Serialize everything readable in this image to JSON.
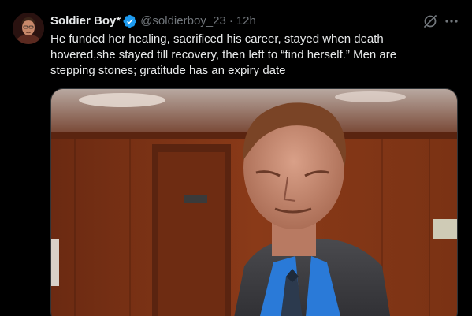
{
  "tweet": {
    "author": {
      "name": "Soldier Boy*",
      "handle": "@soldierboy_23",
      "avatar_icon": "avatar"
    },
    "separator": "·",
    "time": "12h",
    "text": "He funded her healing, sacrificed his career, stayed when death hovered,she stayed till recovery, then left to “find herself.” Men are stepping stones; gratitude has an expiry date",
    "icons": {
      "verified": "verified-badge-icon",
      "grok": "grok-icon",
      "more": "more-icon"
    },
    "colors": {
      "background": "#000000",
      "primary_text": "#e7e9ea",
      "secondary_text": "#71767b",
      "verified": "#1d9bf0"
    }
  }
}
